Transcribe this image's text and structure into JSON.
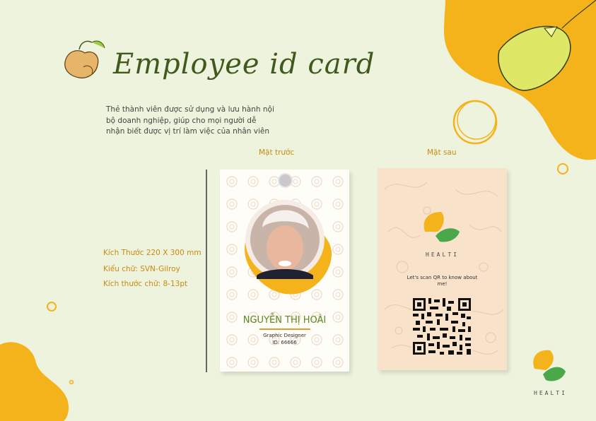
{
  "header": {
    "title": "Employee id card"
  },
  "description": "Thẻ thành viên được sử dụng và lưu hành nội bộ doanh nghiệp, giúp cho mọi người dễ nhận biết được vị trí làm việc của nhân viên",
  "labels": {
    "front": "Mặt trước",
    "back": "Mặt sau"
  },
  "specs": {
    "size": "Kích Thước 220 X 300 mm",
    "font": "Kiểu chữ: SVN-Gilroy",
    "font_size": "Kích thước chữ: 8-13pt"
  },
  "front_card": {
    "name": "NGUYỄN THỊ HOÀI",
    "job_title": "Graphic Designer",
    "employee_id": "ID: 66666"
  },
  "back_card": {
    "brand": "HEALTI",
    "scan_text": "Let's scan QR to know about me!"
  },
  "corner_brand": "HEALTI",
  "colors": {
    "background": "#eef3dd",
    "accent_yellow": "#f4b21b",
    "brand_green": "#3f5a1c",
    "leaf_green": "#4aa84a",
    "peach": "#f8e2c9"
  },
  "icons": [
    "ginger-illustration-icon",
    "lemon-illustration-icon",
    "leaf-logo-icon",
    "qr-code-icon"
  ]
}
